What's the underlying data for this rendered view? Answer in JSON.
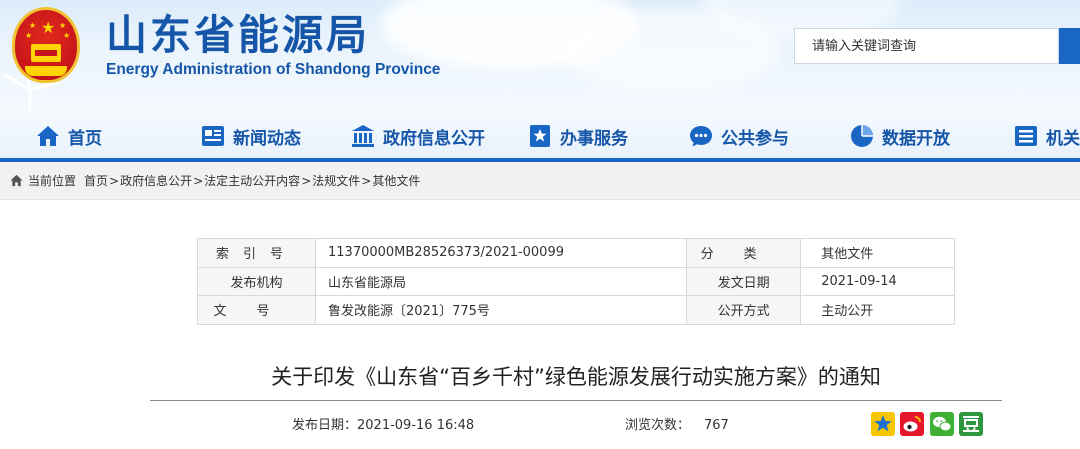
{
  "header": {
    "title": "山东省能源局",
    "subtitle": "Energy Administration of Shandong Province",
    "search_placeholder": "请输入关键词查询"
  },
  "nav": [
    {
      "label": "首页",
      "icon": "home-icon"
    },
    {
      "label": "新闻动态",
      "icon": "news-icon"
    },
    {
      "label": "政府信息公开",
      "icon": "government-building-icon"
    },
    {
      "label": "办事服务",
      "icon": "service-star-icon"
    },
    {
      "label": "公共参与",
      "icon": "chat-bubble-icon"
    },
    {
      "label": "数据开放",
      "icon": "pie-chart-icon"
    },
    {
      "label": "机关",
      "icon": "org-icon"
    }
  ],
  "breadcrumb": {
    "prefix": "当前位置",
    "items": [
      "首页",
      "政府信息公开",
      "法定主动公开内容",
      "法规文件",
      "其他文件"
    ],
    "separator": ">"
  },
  "info": {
    "index_no_label": "索引号",
    "index_no": "11370000MB28526373/2021-00099",
    "category_label": "分类",
    "category": "其他文件",
    "issuer_label": "发布机构",
    "issuer": "山东省能源局",
    "issue_date_label": "发文日期",
    "issue_date": "2021-09-14",
    "doc_no_label": "文号",
    "doc_no": "鲁发改能源〔2021〕775号",
    "disclosure_label": "公开方式",
    "disclosure": "主动公开"
  },
  "article": {
    "title": "关于印发《山东省“百乡千村”绿色能源发展行动实施方案》的通知",
    "publish_label": "发布日期：",
    "publish_date": "2021-09-16 16:48",
    "views_label": "浏览次数：",
    "views": "767"
  },
  "share": [
    {
      "icon": "qzone-star-icon",
      "color": "#f2b705"
    },
    {
      "icon": "weibo-icon",
      "color": "#e6162d"
    },
    {
      "icon": "wechat-icon",
      "color": "#3eb135"
    },
    {
      "icon": "douban-icon",
      "color": "#2e963d"
    }
  ]
}
